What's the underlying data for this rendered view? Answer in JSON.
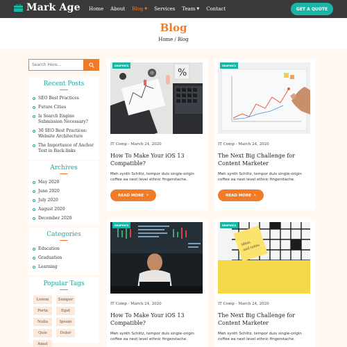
{
  "brand": {
    "name": "Mark Age",
    "icon": "briefcase-icon"
  },
  "nav": {
    "items": [
      {
        "label": "Home"
      },
      {
        "label": "About"
      },
      {
        "label": "Blog",
        "active": true
      },
      {
        "label": "Services"
      },
      {
        "label": "Team"
      },
      {
        "label": "Contact"
      }
    ],
    "cta": "GET A QUOTE"
  },
  "header": {
    "title": "Blog",
    "breadcrumb": [
      "Home",
      "/",
      "Blog"
    ]
  },
  "sidebar": {
    "search": {
      "placeholder": "Search Here..."
    },
    "recent": {
      "title": "Recent Posts",
      "items": [
        "SEO Best Practices",
        "Future Cities",
        "Is Search Engine Submission Necessary?",
        "30 SEO Best Practices: Website Architecture",
        "The Importance of Anchor Text in Back-links"
      ]
    },
    "archives": {
      "title": "Archives",
      "items": [
        "May 2020",
        "June 2020",
        "July 2020",
        "August 2020",
        "December 2020"
      ]
    },
    "categories": {
      "title": "Categories",
      "items": [
        "Education",
        "Graduation",
        "Learning"
      ]
    },
    "tags": {
      "title": "Popular Tags",
      "items": [
        "Lorem",
        "Semper",
        "Porta",
        "Eget",
        "Nulla",
        "Ipsum",
        "Quis",
        "Dolor",
        "Amet"
      ]
    }
  },
  "posts": [
    {
      "badge": "GRAPHICS",
      "meta": "IT Comp - March 24, 2020",
      "title": "How To Make Your iOS 13 Compatible?",
      "excerpt": "Meh synth Schlitz, tempor duis single-origin coffee ea next level ethnic fingerstache.",
      "button": "READ MORE"
    },
    {
      "badge": "GRAPHICS",
      "meta": "IT Comp - March 24, 2020",
      "title": "The Next Big Challenge for Content Marketer",
      "excerpt": "Meh synth Schlitz, tempor duis single-origin coffee ea next level ethnic fingerstache.",
      "button": "READ MORE"
    },
    {
      "badge": "GRAPHICS",
      "meta": "IT Comp - March 24, 2020",
      "title": "How To Make Your iOS 13 Compatible?",
      "excerpt": "Meh synth Schlitz, tempor duis single-origin coffee ea next level ethnic fingerstache."
    },
    {
      "badge": "GRAPHICS",
      "meta": "IT Comp - March 24, 2020",
      "title": "The Next Big Challenge for Content Marketer",
      "excerpt": "Meh synth Schlitz, tempor duis single-origin coffee ea next level ethnic fingerstache."
    }
  ],
  "colors": {
    "accent": "#f07c2a",
    "teal": "#1bb5a6",
    "nav_bg": "#3a3a3a"
  }
}
